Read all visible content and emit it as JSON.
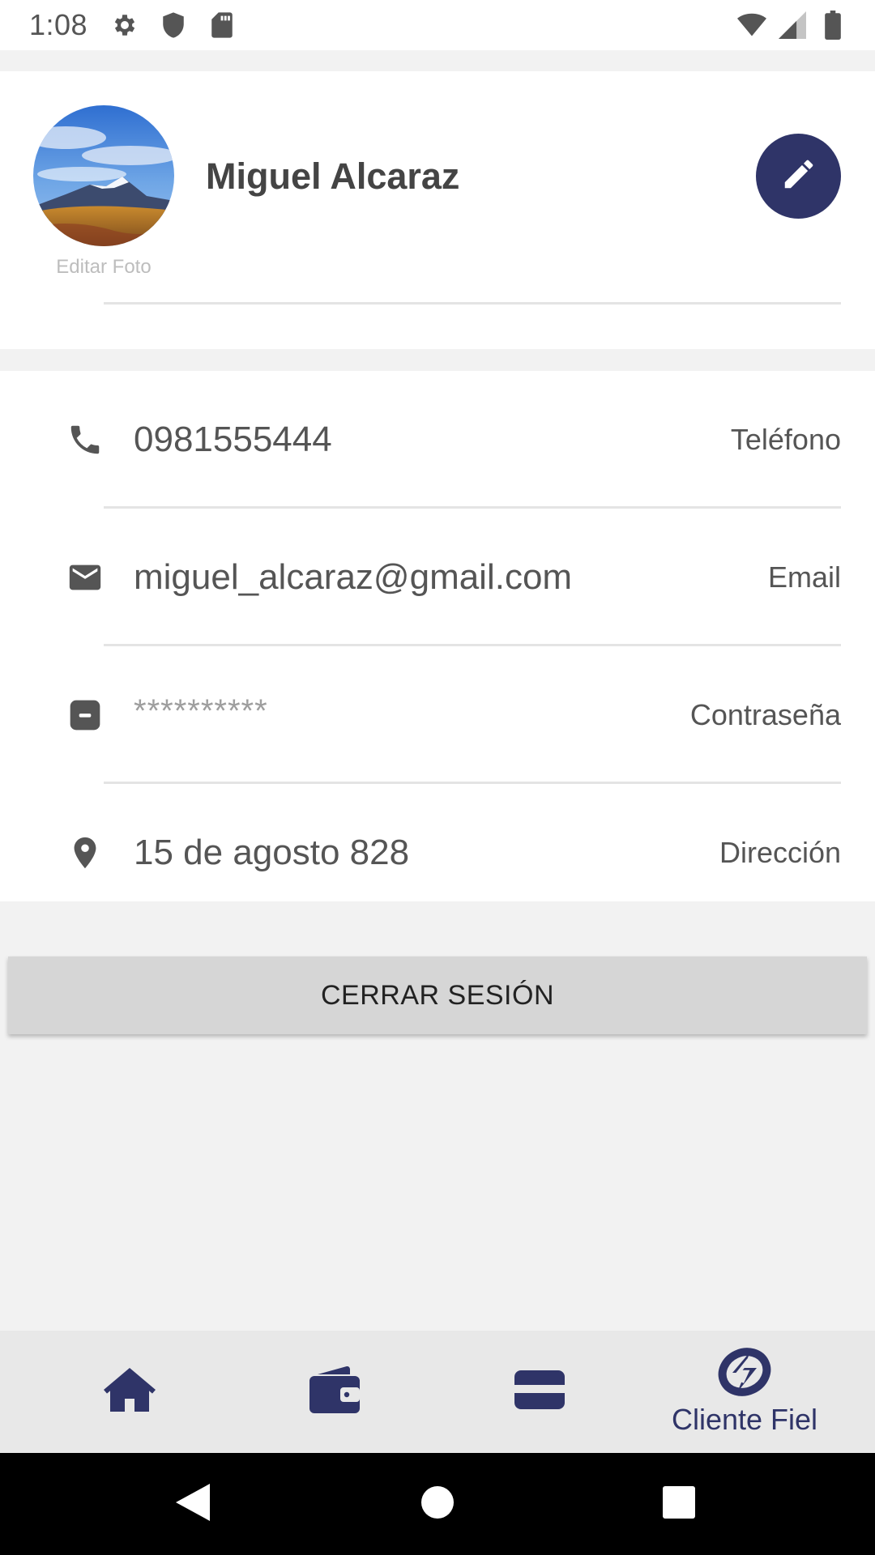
{
  "status_bar": {
    "time": "1:08",
    "icons": [
      "settings-icon",
      "shield-icon",
      "sd-card-icon",
      "wifi-icon",
      "cell-signal-icon",
      "battery-icon"
    ]
  },
  "profile": {
    "name": "Miguel Alcaraz",
    "edit_photo_label": "Editar Foto",
    "edit_button_icon": "pencil-icon"
  },
  "info": {
    "rows": [
      {
        "icon": "phone-icon",
        "value": "0981555444",
        "label": "Teléfono"
      },
      {
        "icon": "email-icon",
        "value": "miguel_alcaraz@gmail.com",
        "label": "Email"
      },
      {
        "icon": "password-icon",
        "value": "**********",
        "label": "Contraseña"
      },
      {
        "icon": "location-pin-icon",
        "value": "15 de agosto 828",
        "label": "Dirección"
      }
    ]
  },
  "logout_button_label": "CERRAR SESIÓN",
  "bottom_nav": {
    "items": [
      {
        "icon": "home-icon"
      },
      {
        "icon": "wallet-icon"
      },
      {
        "icon": "card-icon"
      },
      {
        "icon": "cliente-fiel-logo-icon",
        "label": "Cliente Fiel"
      }
    ]
  },
  "colors": {
    "accent": "#2f3468",
    "background": "#f2f2f2",
    "card": "#ffffff",
    "button": "#d6d6d6"
  }
}
